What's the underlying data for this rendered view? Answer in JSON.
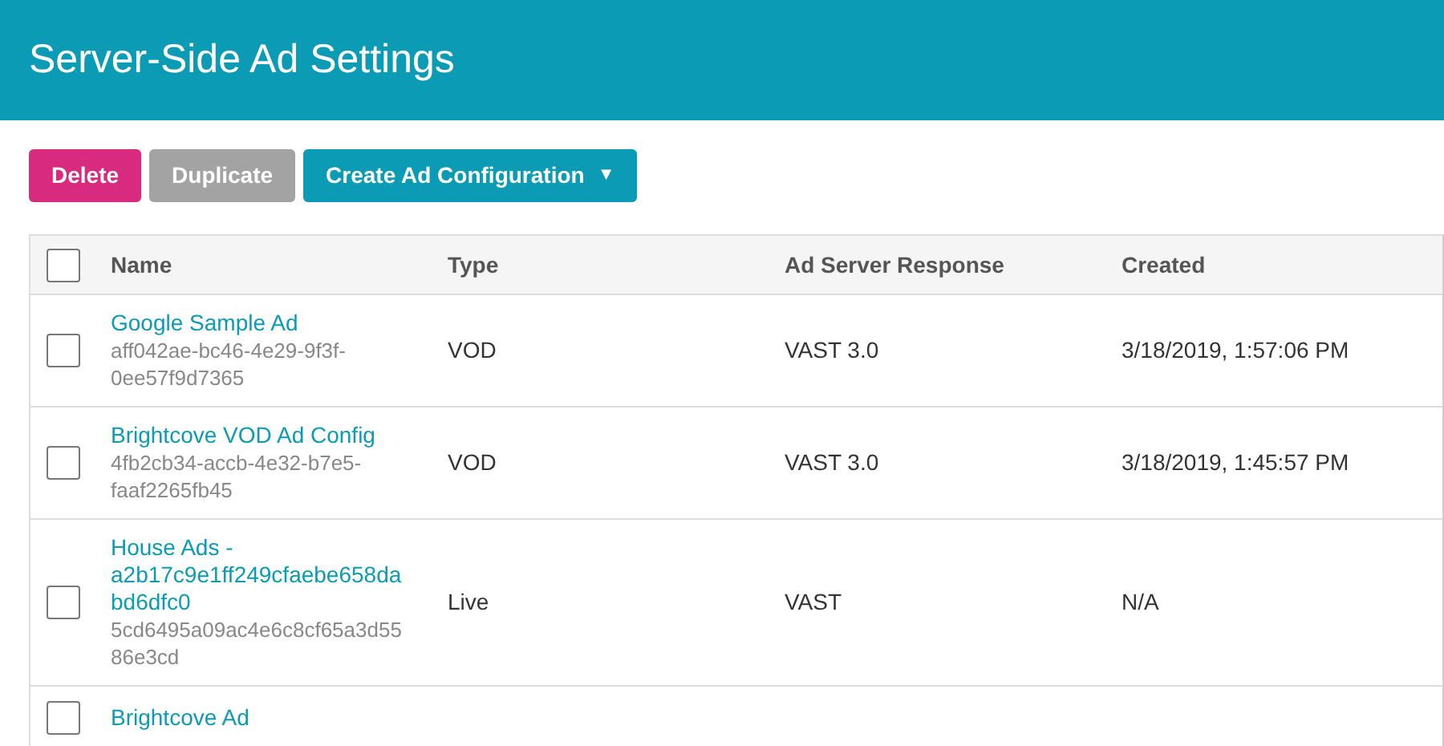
{
  "header": {
    "title": "Server-Side Ad Settings"
  },
  "toolbar": {
    "buttons": [
      {
        "label": "Delete",
        "kind": "danger",
        "disabled": false
      },
      {
        "label": "Duplicate",
        "disabled": true
      },
      {
        "label": "Create Ad Configuration",
        "kind": "primary",
        "disabled": false,
        "caret": "▼"
      }
    ]
  },
  "table": {
    "select_all_checked": false,
    "columns": [
      "Name",
      "Type",
      "Ad Server Response",
      "Created"
    ],
    "rows": [
      {
        "checked": false,
        "name": "Google Sample Ad",
        "id": "aff042ae-bc46-4e29-9f3f-0ee57f9d7365",
        "type": "VOD",
        "response": "VAST 3.0",
        "created": "3/18/2019, 1:57:06 PM"
      },
      {
        "checked": false,
        "name": "Brightcove VOD Ad Config",
        "id": "4fb2cb34-accb-4e32-b7e5-faaf2265fb45",
        "type": "VOD",
        "response": "VAST 3.0",
        "created": "3/18/2019, 1:45:57 PM"
      },
      {
        "checked": false,
        "name": "House Ads - a2b17c9e1ff249cfaebe658dabd6dfc0",
        "id": "5cd6495a09ac4e6c8cf65a3d5586e3cd",
        "type": "Live",
        "response": "VAST",
        "created": "N/A"
      },
      {
        "checked": false,
        "name": "Brightcove Ad"
      }
    ]
  }
}
